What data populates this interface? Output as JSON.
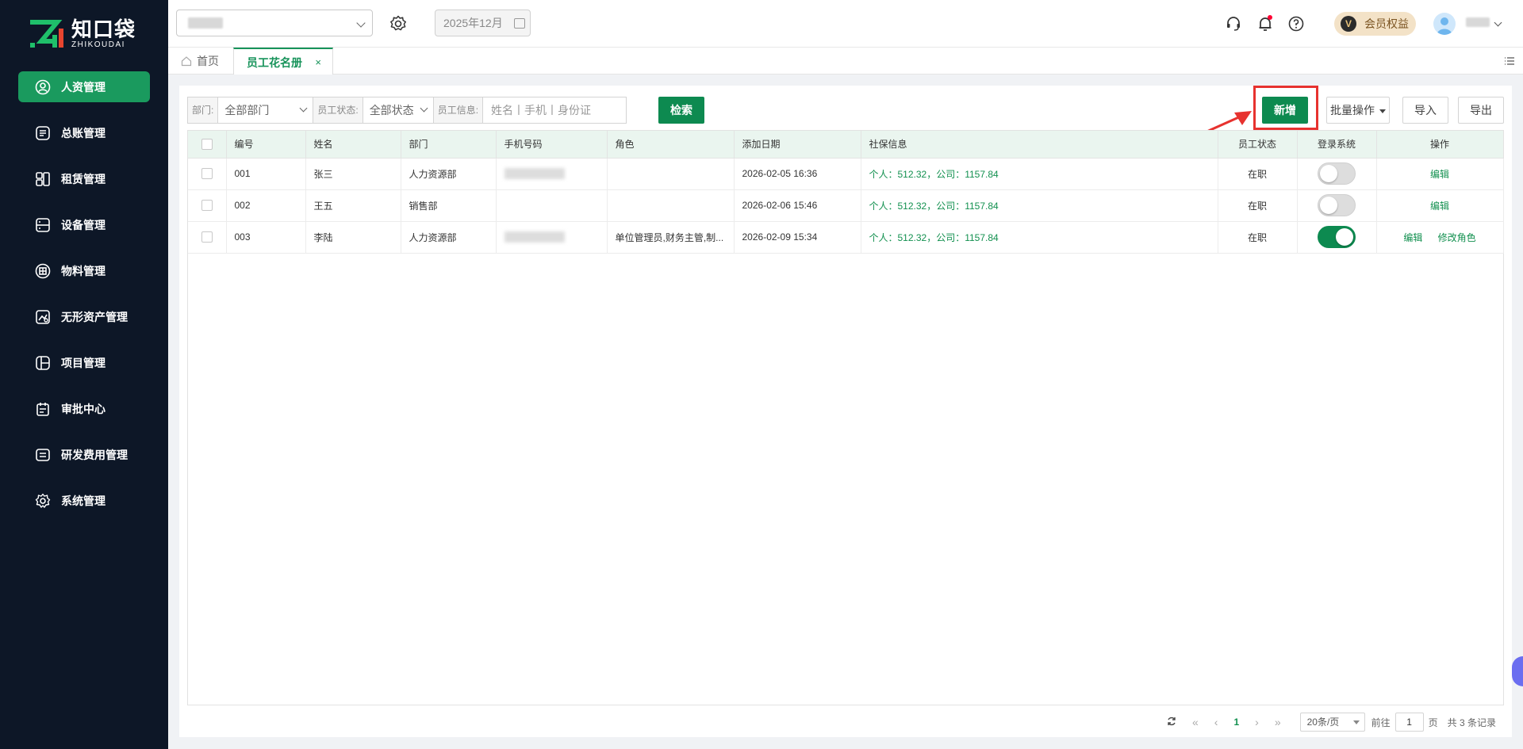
{
  "brand": {
    "name_cn": "知口袋",
    "name_en": "ZHIKOUDAI",
    "accent": "#1a9a5e"
  },
  "sidebar": {
    "items": [
      {
        "label": "人资管理",
        "icon": "user-circle-icon",
        "active": true
      },
      {
        "label": "总账管理",
        "icon": "ledger-icon"
      },
      {
        "label": "租赁管理",
        "icon": "lease-icon"
      },
      {
        "label": "设备管理",
        "icon": "device-icon"
      },
      {
        "label": "物料管理",
        "icon": "material-icon"
      },
      {
        "label": "无形资产管理",
        "icon": "intangible-asset-icon"
      },
      {
        "label": "项目管理",
        "icon": "project-icon"
      },
      {
        "label": "审批中心",
        "icon": "approval-icon"
      },
      {
        "label": "研发费用管理",
        "icon": "rd-expense-icon"
      },
      {
        "label": "系统管理",
        "icon": "gear-icon"
      }
    ]
  },
  "header": {
    "period": "2025年12月",
    "vip_label": "会员权益",
    "vip_badge": "V"
  },
  "tabs": {
    "home": "首页",
    "active": "员工花名册",
    "close": "×"
  },
  "filters": {
    "dept_label": "部门:",
    "dept_value": "全部部门",
    "status_label": "员工状态:",
    "status_value": "全部状态",
    "info_label": "员工信息:",
    "info_placeholder": "姓名丨手机丨身份证",
    "search_btn": "检索"
  },
  "actions": {
    "add": "新增",
    "batch": "批量操作",
    "import": "导入",
    "export": "导出"
  },
  "table": {
    "headers": [
      "编号",
      "姓名",
      "部门",
      "手机号码",
      "角色",
      "添加日期",
      "社保信息",
      "员工状态",
      "登录系统",
      "操作"
    ],
    "rows": [
      {
        "id": "001",
        "name": "张三",
        "dept": "人力资源部",
        "role": "",
        "date": "2026-02-05 16:36",
        "social": "个人：512.32，公司：1157.84",
        "status": "在职",
        "login": false,
        "ops": [
          "编辑"
        ]
      },
      {
        "id": "002",
        "name": "王五",
        "dept": "销售部",
        "role": "",
        "date": "2026-02-06 15:46",
        "social": "个人：512.32，公司：1157.84",
        "status": "在职",
        "login": false,
        "ops": [
          "编辑"
        ]
      },
      {
        "id": "003",
        "name": "李陆",
        "dept": "人力资源部",
        "role": "单位管理员,财务主管,制...",
        "date": "2026-02-09 15:34",
        "social": "个人：512.32，公司：1157.84",
        "status": "在职",
        "login": true,
        "ops": [
          "编辑",
          "修改角色"
        ]
      }
    ]
  },
  "pagination": {
    "current": "1",
    "page_size": "20条/页",
    "goto_label": "前往",
    "goto_value": "1",
    "page_unit": "页",
    "total": "共 3 条记录"
  }
}
